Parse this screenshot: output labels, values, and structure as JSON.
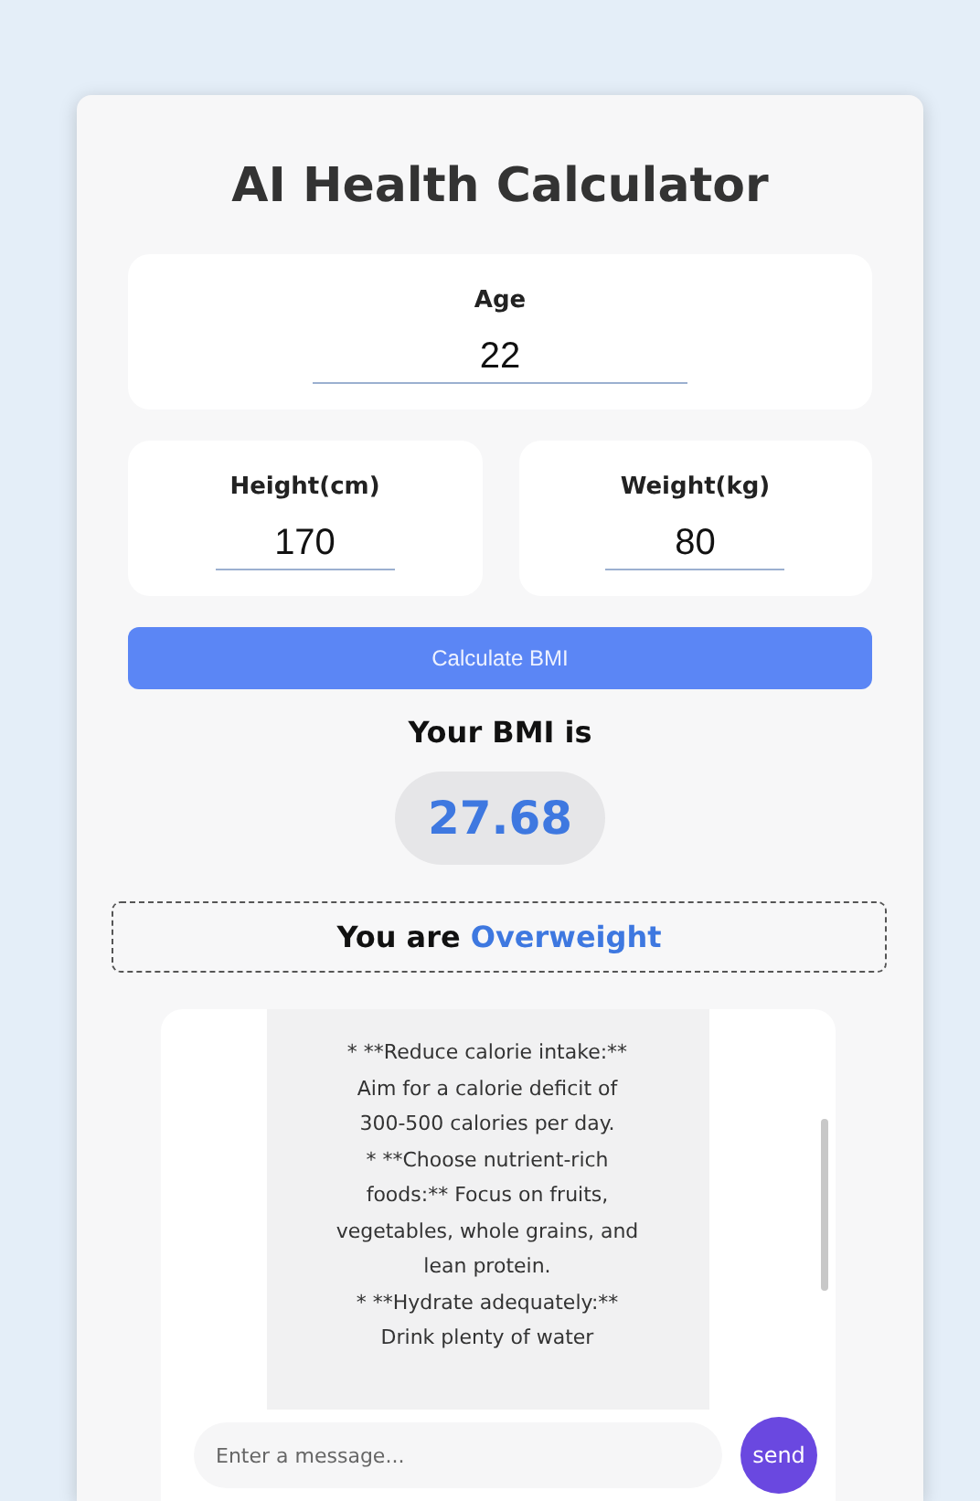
{
  "title": "AI Health Calculator",
  "fields": [
    {
      "label": "Age",
      "value": "22"
    },
    {
      "label": "Height(cm)",
      "value": "170"
    },
    {
      "label": "Weight(kg)",
      "value": "80"
    }
  ],
  "calculate_button": "Calculate BMI",
  "result": {
    "heading": "Your BMI is",
    "bmi": "27.68",
    "category_prefix": "You are",
    "category": "Overweight"
  },
  "chat": {
    "message_lines": [
      "* **Reduce calorie intake:**",
      "Aim for a calorie deficit of",
      "300-500 calories per day.",
      "* **Choose nutrient-rich",
      "foods:** Focus on fruits,",
      "vegetables, whole grains, and",
      "lean protein.",
      "* **Hydrate adequately:**",
      "Drink plenty of water"
    ],
    "placeholder": "Enter a message...",
    "send_button": "send"
  }
}
